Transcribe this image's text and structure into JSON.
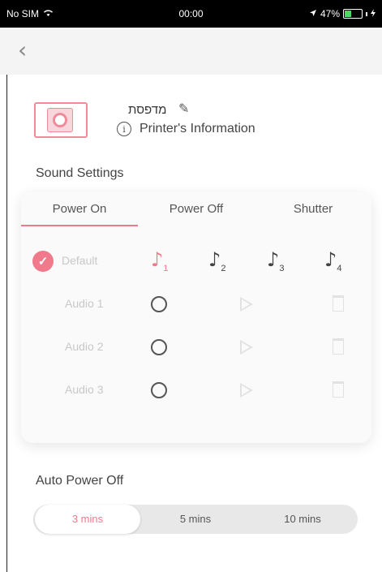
{
  "status_bar": {
    "carrier": "No SIM",
    "time": "00:00",
    "battery_percent": "47%",
    "battery_level": 0.47
  },
  "printer": {
    "name": "מדפסת",
    "info_label": "Printer's Information"
  },
  "sound_settings": {
    "title": "Sound Settings",
    "tabs": [
      "Power On",
      "Power Off",
      "Shutter"
    ],
    "active_tab": "Power On",
    "default_label": "Default",
    "notes": [
      "1",
      "2",
      "3",
      "4"
    ],
    "audio_rows": [
      "Audio 1",
      "Audio 2",
      "Audio 3"
    ]
  },
  "auto_power_off": {
    "title": "Auto Power Off",
    "options": [
      "3 mins",
      "5 mins",
      "10 mins"
    ],
    "selected": "3 mins"
  },
  "colors": {
    "accent": "#f07a8c",
    "card_bg": "#fafafa",
    "segment_bg": "#e8e8e8"
  }
}
